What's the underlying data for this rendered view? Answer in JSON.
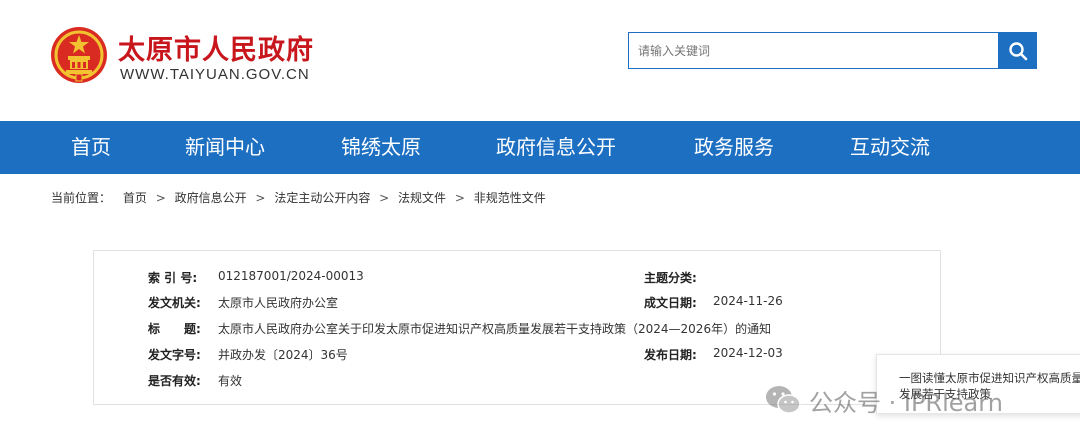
{
  "header": {
    "title": "太原市人民政府",
    "url": "WWW.TAIYUAN.GOV.CN",
    "search_placeholder": "请输入关键词"
  },
  "nav": {
    "items": [
      {
        "label": "首页"
      },
      {
        "label": "新闻中心"
      },
      {
        "label": "锦绣太原"
      },
      {
        "label": "政府信息公开"
      },
      {
        "label": "政务服务"
      },
      {
        "label": "互动交流"
      }
    ]
  },
  "breadcrumb": {
    "prefix": "当前位置：",
    "items": [
      "首页",
      "政府信息公开",
      "法定主动公开内容",
      "法规文件",
      "非规范性文件"
    ],
    "separator": ">"
  },
  "document_info": {
    "index_label": "索 引 号:",
    "index_value": "012187001/2024-00013",
    "topic_label": "主题分类:",
    "topic_value": "",
    "issuer_label": "发文机关:",
    "issuer_value": "太原市人民政府办公室",
    "date_created_label": "成文日期:",
    "date_created_value": "2024-11-26",
    "title_label": "标　　题:",
    "title_value": "太原市人民政府办公室关于印发太原市促进知识产权高质量发展若干支持政策（2024—2026年）的通知",
    "doc_number_label": "发文字号:",
    "doc_number_value": "并政办发〔2024〕36号",
    "publish_date_label": "发布日期:",
    "publish_date_value": "2024-12-03",
    "validity_label": "是否有效:",
    "validity_value": "有效"
  },
  "popup": {
    "text": "一图读懂太原市促进知识产权高质量发展若干支持政策"
  },
  "watermark": {
    "text": "公众号 · IPRlearn"
  },
  "colors": {
    "brand_blue": "#1d6fc2",
    "title_red": "#c8161d"
  }
}
